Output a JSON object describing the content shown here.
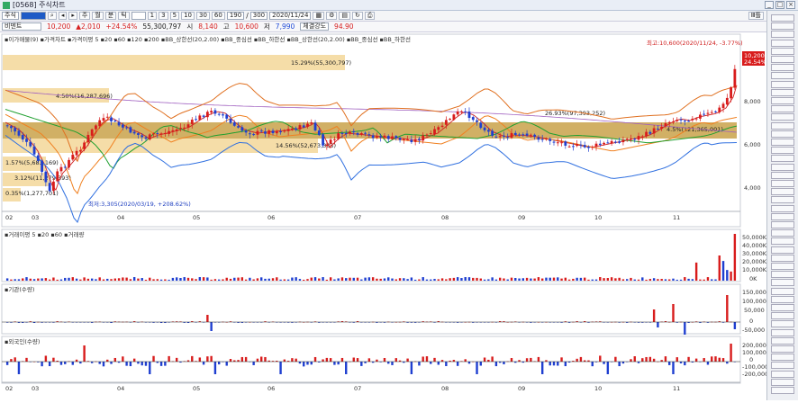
{
  "window": {
    "title": "[0568] 주식차트"
  },
  "toolbar": {
    "market": "주식",
    "code": "",
    "periods": [
      "주",
      "월",
      "분",
      "틱"
    ],
    "minute_buttons": [
      "1",
      "3",
      "5",
      "10",
      "30",
      "60"
    ],
    "count": "190",
    "max_count": "300",
    "date": "2020/11/24",
    "right_btn": "Ⅲ틀"
  },
  "quote": {
    "name": "비덴트",
    "price": "10,200",
    "change": "▲2,010",
    "change_pct": "+24.54%",
    "volume": "55,300,797",
    "open_label": "시",
    "open": "8,140",
    "high_label": "고",
    "high": "10,600",
    "low_label": "저",
    "low": "7,990",
    "strength_label": "체결강도",
    "strength": "94.90"
  },
  "price_panel": {
    "legend": "▪이가매물(9) ▪가격차트 ▪가격이평 5 ▪20 ▪60 ▪120 ▪200 ▪BB_상한선(20,2.00) ▪BB_중심선 ▪BB_하한선 ▪BB_상한선(20,2.00) ▪BB_중심선 ▪BB_하한선",
    "annot_high": "최고:10,600(2020/11/24, -3.77%)",
    "annot_low": "최저:3,305(2020/03/19, +208.62%)",
    "price_tag": "10,200",
    "pct_tag": "24.54%",
    "vp_labels": [
      "15.29%(55,300,797)",
      "4.50%(16,287,696)",
      "26.93%(97,393,252)",
      "14.56%(52,673,383)",
      "1.57%(5,683,169)",
      "3.12%(11,279,393)",
      "0.35%(1,277,701)",
      "4.5%(121,365,001)"
    ],
    "y_ticks": [
      "8,000",
      "6,000",
      "4,000"
    ],
    "x_ticks": [
      "02",
      "03",
      "04",
      "05",
      "06",
      "07",
      "08",
      "09",
      "10",
      "11"
    ]
  },
  "volume_panel": {
    "legend": "▪거래이평 5 ▪20 ▪60 ▪거래량",
    "y_ticks": [
      "50,000K",
      "40,000K",
      "30,000K",
      "20,000K",
      "10,000K",
      "0K"
    ]
  },
  "inst_panel": {
    "legend": "▪기관(수량)",
    "y_ticks": [
      "150,000",
      "100,000",
      "50,000",
      "0",
      "-50,000"
    ]
  },
  "foreign_panel": {
    "legend": "▪외국인(수량)",
    "y_ticks": [
      "200,000",
      "100,000",
      "0",
      "-100,000",
      "-200,000"
    ]
  },
  "colors": {
    "up": "#d81c1c",
    "down": "#1f3fd0",
    "ma5": "#d02020",
    "ma20": "#f08020",
    "ma60": "#20a030",
    "ma120": "#a060c0",
    "bb": "#3070e0",
    "vp": "#f3d592",
    "vp_max": "#c9a24a"
  }
}
